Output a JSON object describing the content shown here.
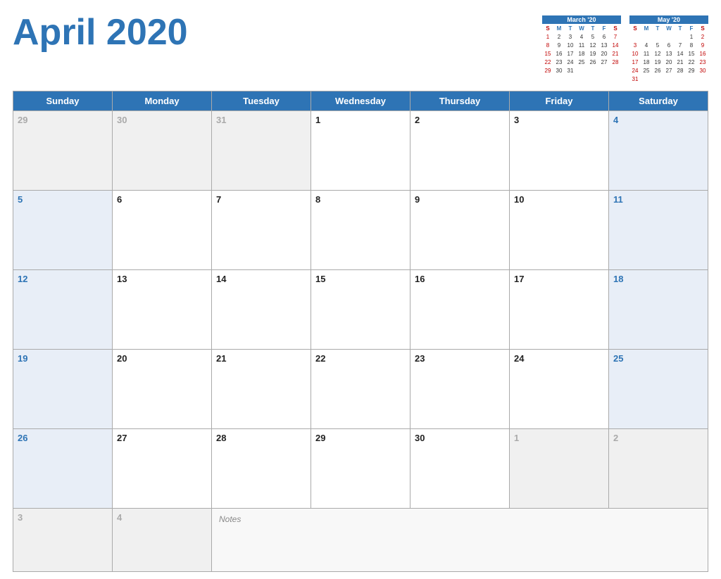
{
  "header": {
    "title": "April 2020"
  },
  "mini_calendars": [
    {
      "title": "March '20",
      "day_labels": [
        "S",
        "M",
        "T",
        "W",
        "T",
        "F",
        "S"
      ],
      "weeks": [
        [
          "",
          "",
          "",
          "",
          "",
          "",
          ""
        ],
        [
          "1",
          "2",
          "3",
          "4",
          "5",
          "6",
          "7"
        ],
        [
          "8",
          "9",
          "10",
          "11",
          "12",
          "13",
          "14"
        ],
        [
          "15",
          "16",
          "17",
          "18",
          "19",
          "20",
          "21"
        ],
        [
          "22",
          "23",
          "24",
          "25",
          "26",
          "27",
          "28"
        ],
        [
          "29",
          "30",
          "31",
          "",
          "",
          "",
          ""
        ]
      ]
    },
    {
      "title": "May '20",
      "day_labels": [
        "S",
        "M",
        "T",
        "W",
        "T",
        "F",
        "S"
      ],
      "weeks": [
        [
          "",
          "",
          "",
          "",
          "",
          "1",
          "2"
        ],
        [
          "3",
          "4",
          "5",
          "6",
          "7",
          "8",
          "9"
        ],
        [
          "10",
          "11",
          "12",
          "13",
          "14",
          "15",
          "16"
        ],
        [
          "17",
          "18",
          "19",
          "20",
          "21",
          "22",
          "23"
        ],
        [
          "24",
          "25",
          "26",
          "27",
          "28",
          "29",
          "30"
        ],
        [
          "31",
          "",
          "",
          "",
          "",
          "",
          ""
        ]
      ]
    }
  ],
  "weekdays": [
    "Sunday",
    "Monday",
    "Tuesday",
    "Wednesday",
    "Thursday",
    "Friday",
    "Saturday"
  ],
  "weeks": [
    [
      {
        "day": "29",
        "in_month": false,
        "is_weekend": true,
        "blue": false
      },
      {
        "day": "30",
        "in_month": false,
        "is_weekend": false,
        "blue": false
      },
      {
        "day": "31",
        "in_month": false,
        "is_weekend": false,
        "blue": false
      },
      {
        "day": "1",
        "in_month": true,
        "is_weekend": false,
        "blue": false
      },
      {
        "day": "2",
        "in_month": true,
        "is_weekend": false,
        "blue": false
      },
      {
        "day": "3",
        "in_month": true,
        "is_weekend": false,
        "blue": false
      },
      {
        "day": "4",
        "in_month": true,
        "is_weekend": true,
        "blue": true
      }
    ],
    [
      {
        "day": "5",
        "in_month": true,
        "is_weekend": true,
        "blue": true
      },
      {
        "day": "6",
        "in_month": true,
        "is_weekend": false,
        "blue": false
      },
      {
        "day": "7",
        "in_month": true,
        "is_weekend": false,
        "blue": false
      },
      {
        "day": "8",
        "in_month": true,
        "is_weekend": false,
        "blue": false
      },
      {
        "day": "9",
        "in_month": true,
        "is_weekend": false,
        "blue": false
      },
      {
        "day": "10",
        "in_month": true,
        "is_weekend": false,
        "blue": false
      },
      {
        "day": "11",
        "in_month": true,
        "is_weekend": true,
        "blue": true
      }
    ],
    [
      {
        "day": "12",
        "in_month": true,
        "is_weekend": true,
        "blue": true
      },
      {
        "day": "13",
        "in_month": true,
        "is_weekend": false,
        "blue": false
      },
      {
        "day": "14",
        "in_month": true,
        "is_weekend": false,
        "blue": false
      },
      {
        "day": "15",
        "in_month": true,
        "is_weekend": false,
        "blue": false
      },
      {
        "day": "16",
        "in_month": true,
        "is_weekend": false,
        "blue": false
      },
      {
        "day": "17",
        "in_month": true,
        "is_weekend": false,
        "blue": false
      },
      {
        "day": "18",
        "in_month": true,
        "is_weekend": true,
        "blue": true
      }
    ],
    [
      {
        "day": "19",
        "in_month": true,
        "is_weekend": true,
        "blue": true
      },
      {
        "day": "20",
        "in_month": true,
        "is_weekend": false,
        "blue": false
      },
      {
        "day": "21",
        "in_month": true,
        "is_weekend": false,
        "blue": false
      },
      {
        "day": "22",
        "in_month": true,
        "is_weekend": false,
        "blue": false
      },
      {
        "day": "23",
        "in_month": true,
        "is_weekend": false,
        "blue": false
      },
      {
        "day": "24",
        "in_month": true,
        "is_weekend": false,
        "blue": false
      },
      {
        "day": "25",
        "in_month": true,
        "is_weekend": true,
        "blue": true
      }
    ],
    [
      {
        "day": "26",
        "in_month": true,
        "is_weekend": true,
        "blue": true
      },
      {
        "day": "27",
        "in_month": true,
        "is_weekend": false,
        "blue": false
      },
      {
        "day": "28",
        "in_month": true,
        "is_weekend": false,
        "blue": false
      },
      {
        "day": "29",
        "in_month": true,
        "is_weekend": false,
        "blue": false
      },
      {
        "day": "30",
        "in_month": true,
        "is_weekend": false,
        "blue": false
      },
      {
        "day": "1",
        "in_month": false,
        "is_weekend": false,
        "blue": false
      },
      {
        "day": "2",
        "in_month": false,
        "is_weekend": true,
        "blue": false
      }
    ]
  ],
  "last_row": {
    "cells": [
      {
        "day": "3",
        "in_month": false
      },
      {
        "day": "4",
        "in_month": false
      }
    ],
    "notes_label": "Notes"
  }
}
